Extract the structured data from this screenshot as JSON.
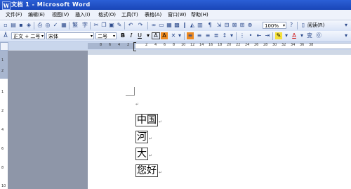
{
  "window": {
    "title": "文档 1 - Microsoft Word",
    "icon_letter": "W"
  },
  "menu": [
    "文件(F)",
    "编辑(E)",
    "视图(V)",
    "插入(I)",
    "格式(O)",
    "工具(T)",
    "表格(A)",
    "窗口(W)",
    "帮助(H)"
  ],
  "toolbar1": {
    "zoom": "100%",
    "read_label": "阅读(R)"
  },
  "toolbar2": {
    "style": "正文 + 二号",
    "font": "宋体",
    "size": "二号",
    "bold": "B",
    "italic": "I",
    "underline": "U",
    "char_border": "A",
    "char_shading": "A"
  },
  "ruler": {
    "left_labels": [
      "8",
      "6",
      "4",
      "2"
    ],
    "right_labels": [
      "2",
      "4",
      "6",
      "8",
      "10",
      "12",
      "14",
      "16",
      "18",
      "20",
      "22",
      "24",
      "26",
      "28",
      "30",
      "32",
      "34",
      "36",
      "38"
    ]
  },
  "vruler": {
    "labels": [
      "1",
      "2",
      "1",
      "2",
      "4",
      "6",
      "8",
      "10"
    ]
  },
  "document": {
    "lines": [
      {
        "text": "中国"
      },
      {
        "text": "河"
      },
      {
        "text": "大"
      },
      {
        "text": "您好"
      }
    ]
  }
}
